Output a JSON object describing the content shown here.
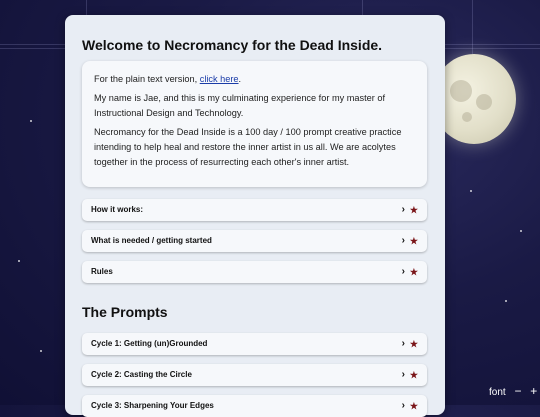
{
  "page": {
    "title": "Welcome to Necromancy for the Dead Inside.",
    "intro": {
      "line1_prefix": "For the plain text version, ",
      "line1_link": "click here",
      "line1_suffix": ".",
      "para2": "My name is Jae, and this is my culminating experience for my master of Instructional Design and Technology.",
      "para3": "Necromancy for the Dead Inside is a 100 day / 100 prompt creative practice intending to help heal and restore the inner artist in us all. We are acolytes together in the process of resurrecting each other's inner artist."
    },
    "info_sections": [
      {
        "label": "How it works:"
      },
      {
        "label": "What is needed / getting started"
      },
      {
        "label": "Rules"
      }
    ],
    "prompts_heading": "The Prompts",
    "cycles": [
      {
        "label": "Cycle 1: Getting (un)Grounded"
      },
      {
        "label": "Cycle 2: Casting the Circle"
      },
      {
        "label": "Cycle 3: Sharpening Your Edges"
      }
    ],
    "accordion_icons": {
      "chevron": "›",
      "mark": "★"
    }
  },
  "font_controls": {
    "label": "font",
    "decrease": "−",
    "increase": "+"
  },
  "colors": {
    "background": "#1a1a45",
    "panel": "#e8edf4",
    "card": "#f6f8fb",
    "link": "#1a3ca8",
    "mark": "#7a1418"
  }
}
